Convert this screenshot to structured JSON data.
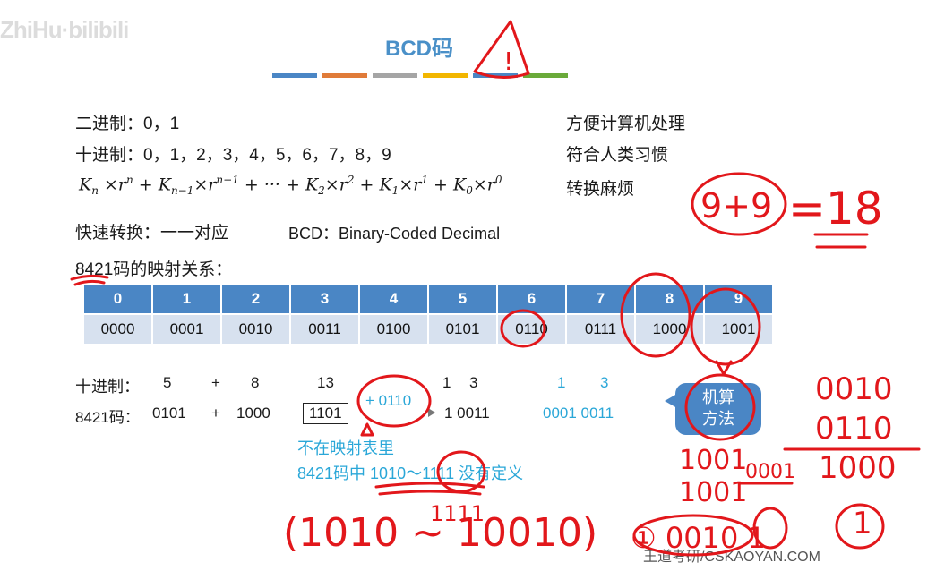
{
  "watermark": "ZhiHu·bilibili",
  "slide": {
    "title": "BCD码",
    "divider_colors": [
      "#4a86c5",
      "#e07b39",
      "#a5a5a5",
      "#f2b600",
      "#4a86c5",
      "#6aaa3a"
    ],
    "lines": {
      "binary": "二进制：0，1",
      "decimal": "十进制：0，1，2，3，4，5，6，7，8，9",
      "fast": "快速转换：一一对应",
      "bcd_name": "BCD：Binary-Coded Decimal",
      "mapping": "8421码的映射关系："
    },
    "notes": {
      "binary": "方便计算机处理",
      "decimal": "符合人类习惯",
      "formula": "转换麻烦"
    },
    "formula": {
      "k": "K",
      "r": "r",
      "times": "×",
      "plus": "+",
      "dots": "+ ··· +",
      "sub_n": "n",
      "sub_n1": "n−1",
      "sup_n1": "n−1",
      "sub_2": "2",
      "sub_1": "1",
      "sub_0": "0",
      "sup_2": "2",
      "sup_1": "1",
      "sup_0": "0"
    },
    "table": {
      "digits": [
        "0",
        "1",
        "2",
        "3",
        "4",
        "5",
        "6",
        "7",
        "8",
        "9"
      ],
      "codes": [
        "0000",
        "0001",
        "0010",
        "0011",
        "0100",
        "0101",
        "0110",
        "0111",
        "1000",
        "1001"
      ]
    },
    "example": {
      "decimal_label": "十进制：",
      "bcd_label": "8421码：",
      "d_a": "5",
      "d_plus": "+",
      "d_b": "8",
      "d_sum": "13",
      "d_res1": "1",
      "d_res2": "3",
      "b_a": "0101",
      "b_plus": "+",
      "b_b": "1000",
      "b_sum": "1101",
      "b_res": "1 0011",
      "correction": "+ 0110",
      "blue_d1": "1",
      "blue_d2": "3",
      "blue_b": "0001  0011",
      "note1": "不在映射表里",
      "note2": "8421码中 1010～1111 没有定义"
    },
    "bubble": {
      "line1": "机算",
      "line2": "方法"
    },
    "footer": "王道考研/CSKAOYAN.COM"
  },
  "ink": {
    "color": "#e2171b",
    "exclaim": "!",
    "sum": "9+9",
    "eq": "=18",
    "col1": "0010",
    "col2": "0110",
    "col3": "1000",
    "col_res": "1",
    "left1": "1001",
    "left2": "1001",
    "left3": "0001",
    "bottom": "(1010 ~ 10010)",
    "bottom_top": "1111",
    "bottom_right": "① 0010 1"
  }
}
